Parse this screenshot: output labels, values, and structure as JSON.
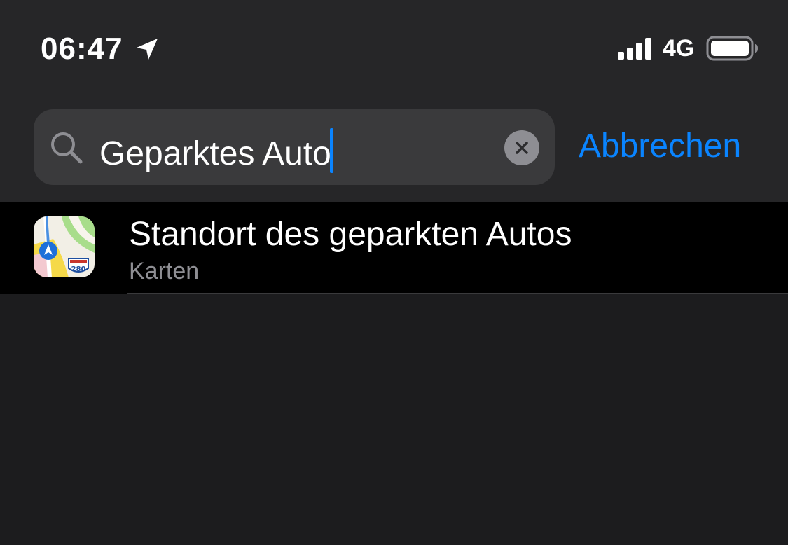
{
  "status_bar": {
    "time": "06:47",
    "location_icon": "location-arrow-icon",
    "signal_icon": "cellular-signal-icon",
    "signal_bars": 4,
    "network": "4G",
    "battery_icon": "battery-icon"
  },
  "search": {
    "icon": "search-icon",
    "value": "Geparktes Auto",
    "clear_icon": "clear-icon",
    "cancel_label": "Abbrechen"
  },
  "results": [
    {
      "app_icon": "maps-app-icon",
      "title": "Standort des geparkten Autos",
      "subtitle": "Karten"
    }
  ],
  "colors": {
    "background": "#1c1c1e",
    "header": "#262628",
    "search_field": "#3a3a3c",
    "accent": "#0a84ff",
    "secondary_text": "#8e8e93",
    "row_background": "#000000"
  }
}
